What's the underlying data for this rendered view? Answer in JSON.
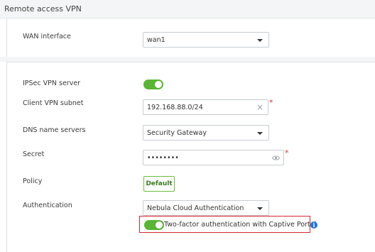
{
  "section": {
    "title": "Remote access VPN"
  },
  "wan": {
    "label": "WAN interface",
    "value": "wan1"
  },
  "ipsec": {
    "label": "IPSec VPN server",
    "enabled": true
  },
  "client_subnet": {
    "label": "Client VPN subnet",
    "value": "192.168.88.0/24",
    "required_mark": "*",
    "clear_glyph": "×"
  },
  "dns": {
    "label": "DNS name servers",
    "value": "Security Gateway"
  },
  "secret": {
    "label": "Secret",
    "value": "••••••••",
    "required_mark": "*"
  },
  "policy": {
    "label": "Policy",
    "button": "Default"
  },
  "authentication": {
    "label": "Authentication",
    "value": "Nebula Cloud Authentication"
  },
  "two_factor": {
    "label": "Two-factor authentication with Captive Portal",
    "enabled": true,
    "info_glyph": "i"
  },
  "colors": {
    "toggle_on": "#5bb435",
    "required": "#e0342b",
    "highlight_border": "#d8262d",
    "info": "#1e73d8"
  }
}
